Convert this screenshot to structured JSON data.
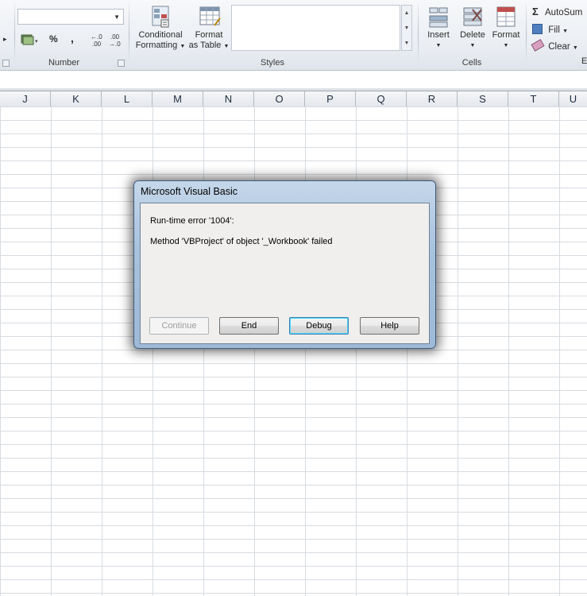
{
  "ribbon": {
    "number_group": {
      "label": "Number",
      "percent_symbol": "%",
      "comma_symbol": ",",
      "increase_decimal": "←.0\n.00",
      "decrease_decimal": ".00\n→.0"
    },
    "conditional_formatting": {
      "line1": "Conditional",
      "line2": "Formatting"
    },
    "format_as_table": {
      "line1": "Format",
      "line2": "as Table"
    },
    "styles_group": {
      "label": "Styles"
    },
    "cells_group": {
      "label": "Cells",
      "insert": "Insert",
      "delete": "Delete",
      "format": "Format"
    },
    "editing_group": {
      "label": "E",
      "autosum": "AutoSum",
      "fill": "Fill",
      "clear": "Clear",
      "sigma": "Σ"
    }
  },
  "columns": [
    "J",
    "K",
    "L",
    "M",
    "N",
    "O",
    "P",
    "Q",
    "R",
    "S",
    "T",
    "U"
  ],
  "dialog": {
    "title": "Microsoft Visual Basic",
    "error_line": "Run-time error '1004':",
    "message": "Method 'VBProject' of object '_Workbook' failed",
    "buttons": {
      "continue": "Continue",
      "end": "End",
      "debug": "Debug",
      "help": "Help"
    }
  }
}
